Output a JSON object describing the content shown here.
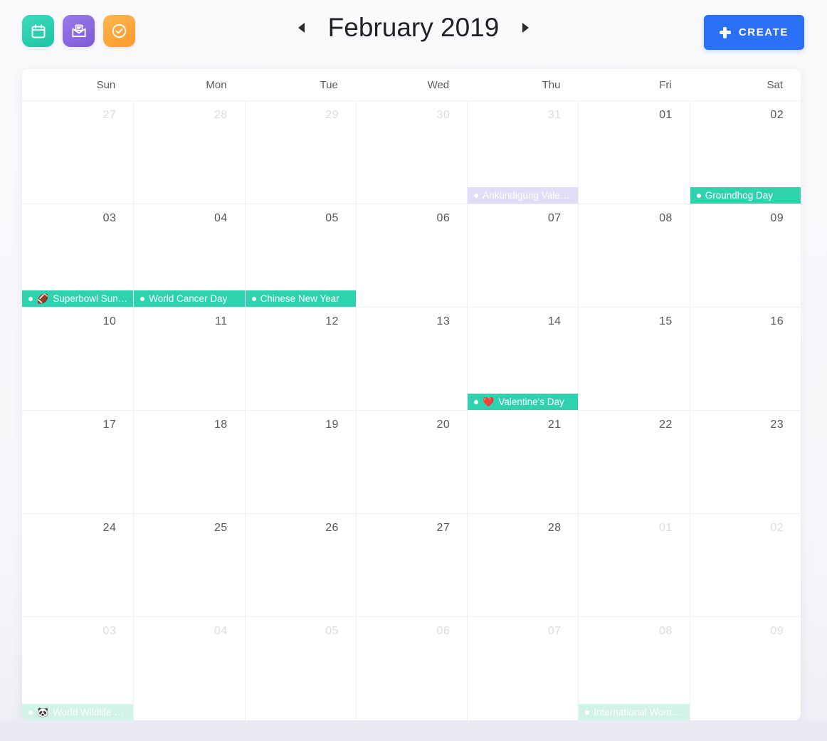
{
  "app_icons": [
    {
      "name": "calendar-app-icon",
      "icon": "calendar-icon",
      "color": "#2fd2ae"
    },
    {
      "name": "mail-app-icon",
      "icon": "mail-list-icon",
      "color": "#8a64e0"
    },
    {
      "name": "tasks-app-icon",
      "icon": "check-circle-icon",
      "color": "#fba733"
    }
  ],
  "header": {
    "month_title": "February 2019",
    "prev_label": "◂",
    "next_label": "▸",
    "create_label": "CREATE",
    "create_color": "#2a70f5"
  },
  "calendar": {
    "weekdays": [
      "Sun",
      "Mon",
      "Tue",
      "Wed",
      "Thu",
      "Fri",
      "Sat"
    ],
    "weeks": [
      [
        {
          "date": "27",
          "other_month": true,
          "events": []
        },
        {
          "date": "28",
          "other_month": true,
          "events": []
        },
        {
          "date": "29",
          "other_month": true,
          "events": []
        },
        {
          "date": "30",
          "other_month": true,
          "events": []
        },
        {
          "date": "31",
          "other_month": true,
          "events": [
            {
              "title": "Ankündigung Valen…",
              "emoji": "",
              "style": "purple-faded"
            }
          ]
        },
        {
          "date": "01",
          "other_month": false,
          "events": []
        },
        {
          "date": "02",
          "other_month": false,
          "events": [
            {
              "title": "Groundhog Day",
              "emoji": "",
              "style": "teal"
            }
          ]
        }
      ],
      [
        {
          "date": "03",
          "other_month": false,
          "events": [
            {
              "title": "Superbowl Sund…",
              "emoji": "🏈",
              "style": "teal"
            }
          ]
        },
        {
          "date": "04",
          "other_month": false,
          "events": [
            {
              "title": "World Cancer Day",
              "emoji": "",
              "style": "teal"
            }
          ]
        },
        {
          "date": "05",
          "other_month": false,
          "events": [
            {
              "title": "Chinese New Year",
              "emoji": "",
              "style": "teal"
            }
          ]
        },
        {
          "date": "06",
          "other_month": false,
          "events": []
        },
        {
          "date": "07",
          "other_month": false,
          "events": []
        },
        {
          "date": "08",
          "other_month": false,
          "events": []
        },
        {
          "date": "09",
          "other_month": false,
          "events": []
        }
      ],
      [
        {
          "date": "10",
          "other_month": false,
          "events": []
        },
        {
          "date": "11",
          "other_month": false,
          "events": []
        },
        {
          "date": "12",
          "other_month": false,
          "events": []
        },
        {
          "date": "13",
          "other_month": false,
          "events": []
        },
        {
          "date": "14",
          "other_month": false,
          "events": [
            {
              "title": "Valentine's Day",
              "emoji": "❤️",
              "style": "teal"
            }
          ]
        },
        {
          "date": "15",
          "other_month": false,
          "events": []
        },
        {
          "date": "16",
          "other_month": false,
          "events": []
        }
      ],
      [
        {
          "date": "17",
          "other_month": false,
          "events": []
        },
        {
          "date": "18",
          "other_month": false,
          "events": []
        },
        {
          "date": "19",
          "other_month": false,
          "events": []
        },
        {
          "date": "20",
          "other_month": false,
          "events": []
        },
        {
          "date": "21",
          "other_month": false,
          "events": []
        },
        {
          "date": "22",
          "other_month": false,
          "events": []
        },
        {
          "date": "23",
          "other_month": false,
          "events": []
        }
      ],
      [
        {
          "date": "24",
          "other_month": false,
          "events": []
        },
        {
          "date": "25",
          "other_month": false,
          "events": []
        },
        {
          "date": "26",
          "other_month": false,
          "events": []
        },
        {
          "date": "27",
          "other_month": false,
          "events": []
        },
        {
          "date": "28",
          "other_month": false,
          "events": []
        },
        {
          "date": "01",
          "other_month": true,
          "events": []
        },
        {
          "date": "02",
          "other_month": true,
          "events": []
        }
      ],
      [
        {
          "date": "03",
          "other_month": true,
          "events": [
            {
              "title": "World Wildlife Day",
              "emoji": "🐼",
              "style": "teal-faded"
            }
          ]
        },
        {
          "date": "04",
          "other_month": true,
          "events": []
        },
        {
          "date": "05",
          "other_month": true,
          "events": []
        },
        {
          "date": "06",
          "other_month": true,
          "events": []
        },
        {
          "date": "07",
          "other_month": true,
          "events": []
        },
        {
          "date": "08",
          "other_month": true,
          "events": [
            {
              "title": "International Wom…",
              "emoji": "",
              "style": "teal-faded"
            }
          ]
        },
        {
          "date": "09",
          "other_month": true,
          "events": []
        }
      ]
    ]
  }
}
